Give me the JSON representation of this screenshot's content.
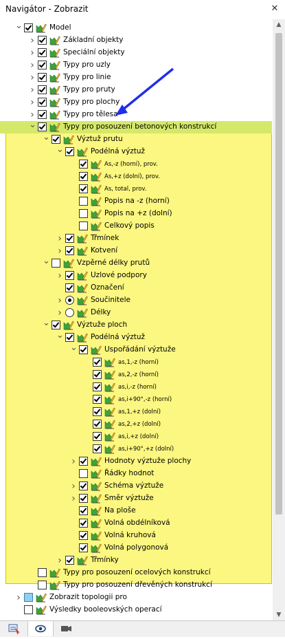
{
  "window": {
    "title": "Navigátor - Zobrazit"
  },
  "tabs": [
    {
      "name": "data-tab-icon"
    },
    {
      "name": "view-tab-icon"
    },
    {
      "name": "camera-tab-icon"
    }
  ],
  "colors": {
    "highlight": "#fbf780",
    "selected_row": "#d6e86a",
    "arrow": "#1f2fe8"
  },
  "tree": {
    "model": "Model",
    "zakladni": "Základní objekty",
    "specialni": "Speciální objekty",
    "uzly": "Typy pro uzly",
    "linie": "Typy pro linie",
    "pruty": "Typy pro pruty",
    "plochy": "Typy pro plochy",
    "telesa": "Typy pro tělesa",
    "beton": "Typy pro posouzení betonových konstrukcí",
    "vyztuz_prutu": "Výztuž prutu",
    "podelna": "Podélná výztuž",
    "as_horni": "As,-z (horní), prov.",
    "as_dolni": "As,+z (dolní), prov.",
    "as_total": "As, total, prov.",
    "popis_horni": "Popis na -z (horní)",
    "popis_dolni": "Popis na +z (dolní)",
    "celkovy": "Celkový popis",
    "trminek": "Třmínek",
    "kotveni": "Kotvení",
    "vzperne": "Vzpěrné délky prutů",
    "uzlove": "Uzlové podpory",
    "oznaceni": "Označení",
    "soucinitele": "Součinitele",
    "delky": "Délky",
    "vyztuze_ploch": "Výztuže ploch",
    "podelna2": "Podélná výztuž",
    "usporadani": "Uspořádání výztuže",
    "a1h": "as,1,-z (horní)",
    "a2h": "as,2,-z (horní)",
    "aih": "as,i,-z (horní)",
    "ai90h": "as,i+90°,-z (horní)",
    "a1d": "as,1,+z (dolní)",
    "a2d": "as,2,+z (dolní)",
    "aid": "as,i,+z (dolní)",
    "ai90d": "as,i+90°,+z (dolní)",
    "hodnoty": "Hodnoty výztuže plochy",
    "radky": "Řádky hodnot",
    "schema": "Schéma výztuže",
    "smer": "Směr výztuže",
    "na_plose": "Na ploše",
    "volna_obd": "Volná obdélníková",
    "volna_kruh": "Volná kruhová",
    "volna_poly": "Volná polygonová",
    "trminky": "Třmínky",
    "ocel": "Typy pro posouzení ocelových konstrukcí",
    "drevo": "Typy pro posouzení dřevěných konstrukcí",
    "topologie": "Zobrazit topologii pro",
    "booleovske": "Výsledky booleovských operací"
  }
}
